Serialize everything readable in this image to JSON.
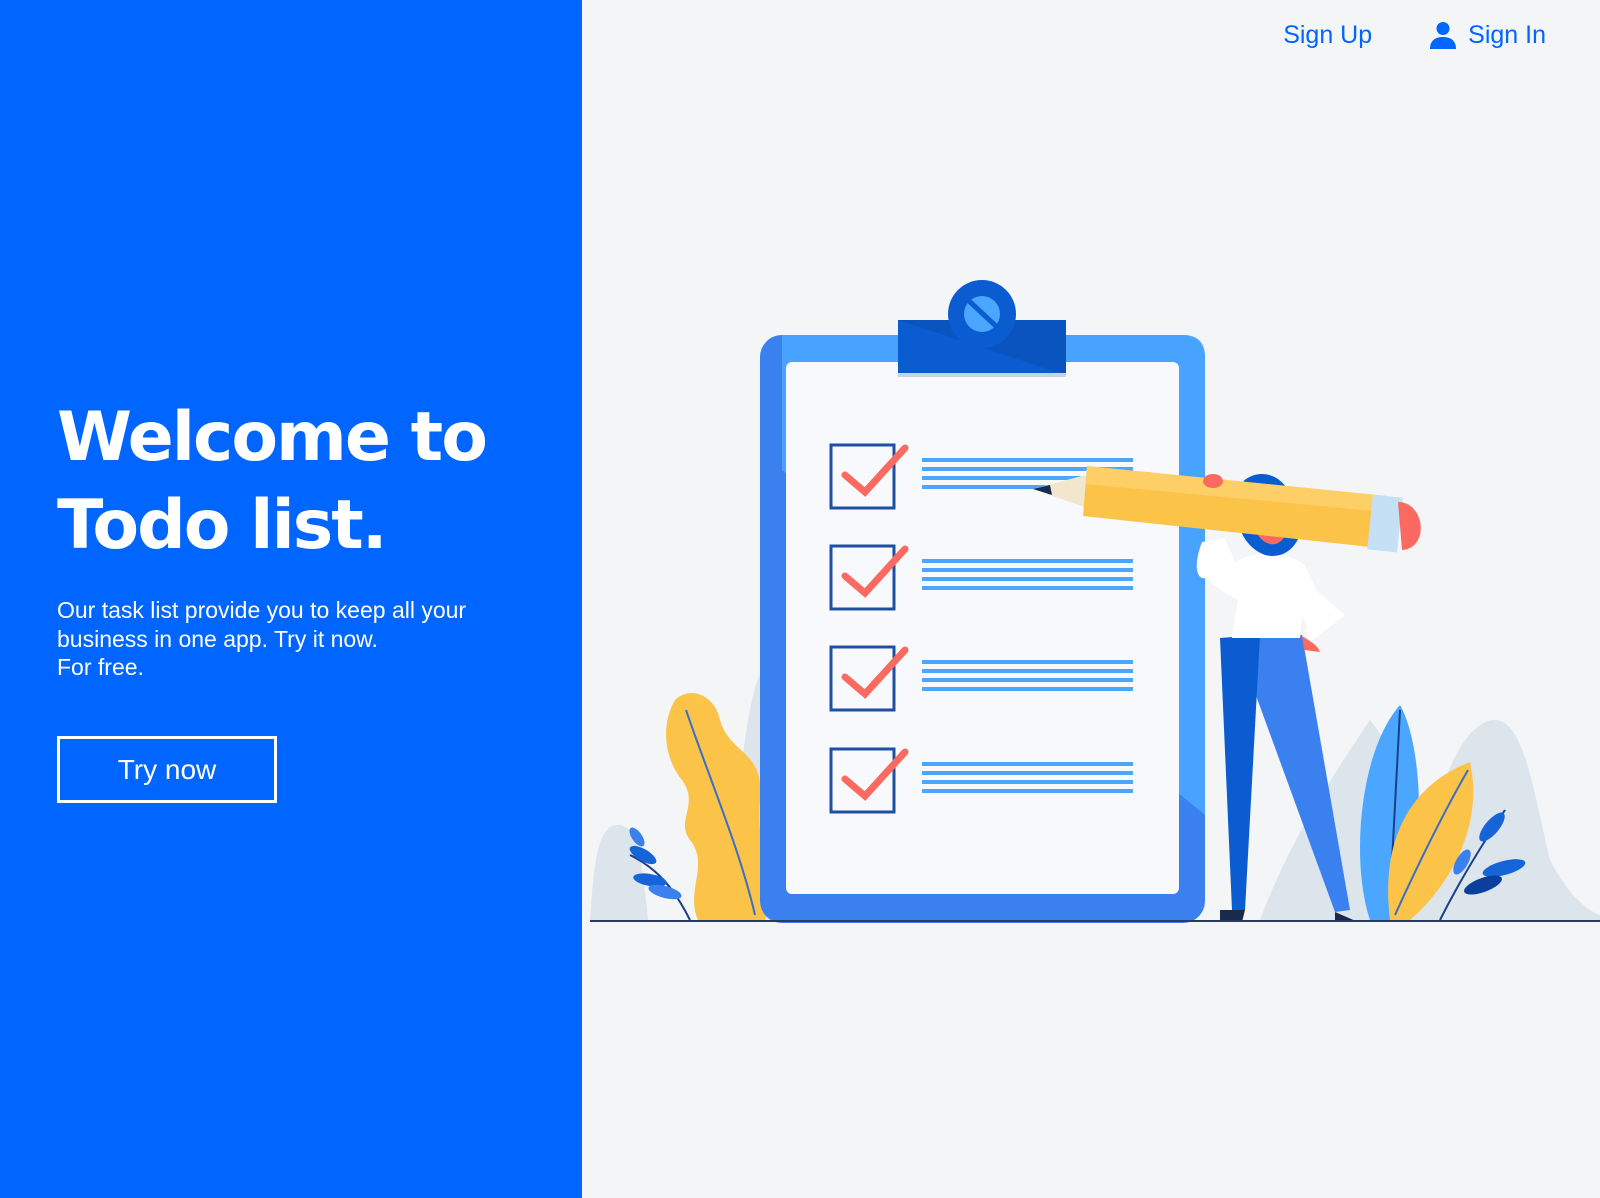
{
  "nav": {
    "sign_up": "Sign Up",
    "sign_in": "Sign In",
    "sign_in_icon": "user-icon"
  },
  "hero": {
    "title_line1": "Welcome to",
    "title_line2": "Todo list.",
    "description_line1": "Our task list provide you to keep all your",
    "description_line2": "business in one app. Try it now.",
    "description_line3": "For free.",
    "cta_label": "Try now"
  },
  "illustration": {
    "checklist_items": 4,
    "checked_items": 4
  },
  "colors": {
    "brand": "#0066ff",
    "background": "#f3f5f7",
    "check": "#fa6a61",
    "pencil": "#fcc349",
    "clipboard": "#3a80ee"
  }
}
